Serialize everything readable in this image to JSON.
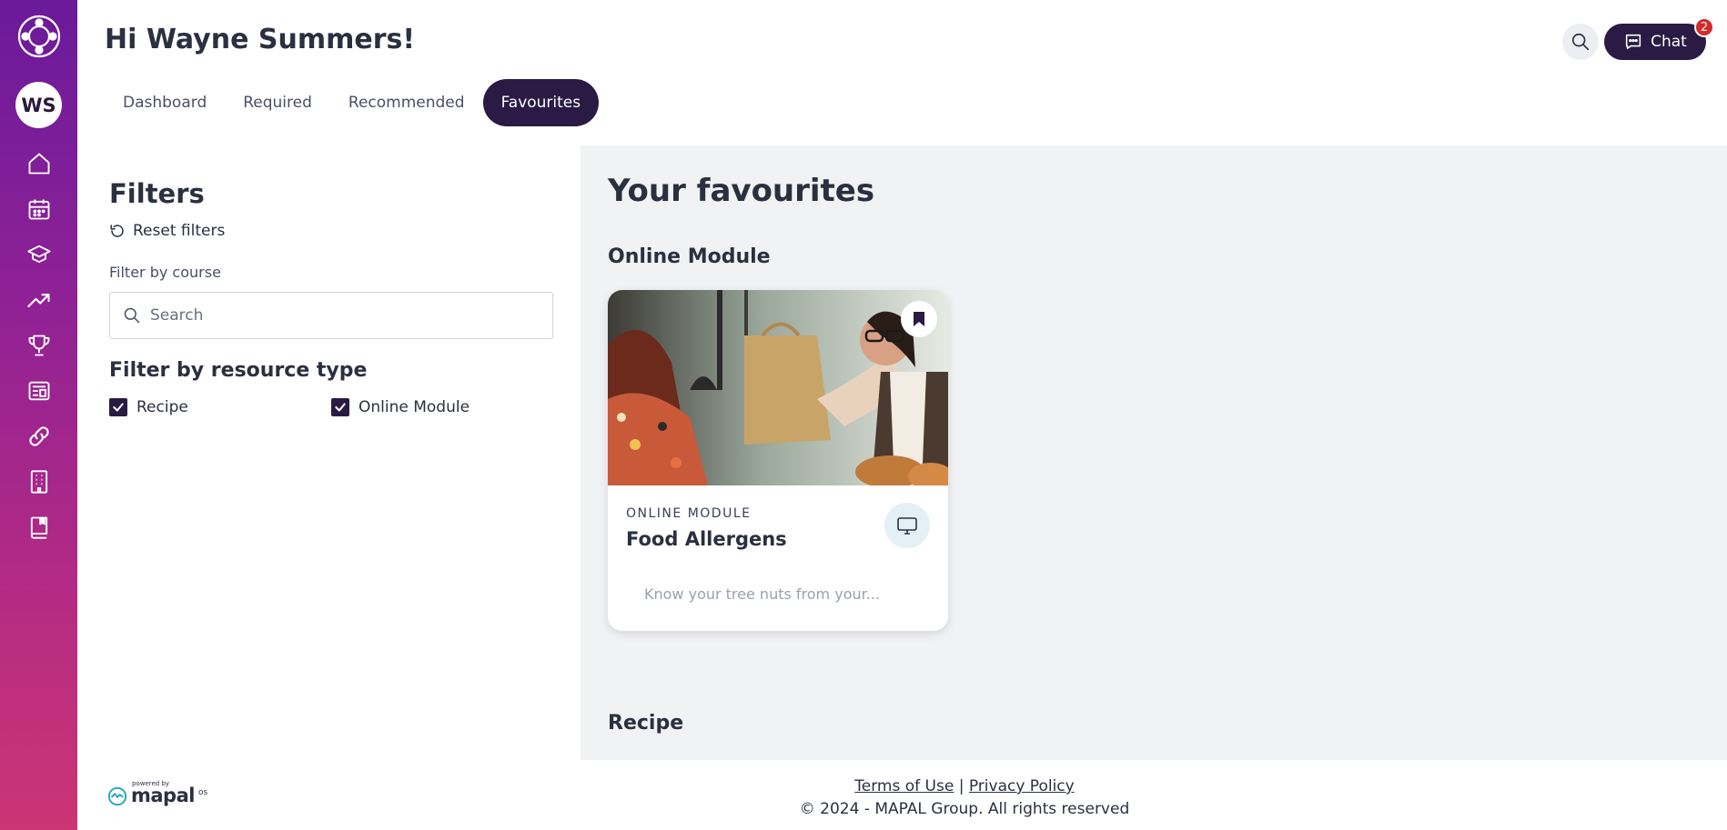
{
  "user": {
    "initials": "WS",
    "greeting": "Hi Wayne Summers!"
  },
  "sidebar": {
    "items": [
      {
        "icon": "home-icon"
      },
      {
        "icon": "calendar-icon"
      },
      {
        "icon": "graduation-cap-icon"
      },
      {
        "icon": "trending-up-icon"
      },
      {
        "icon": "trophy-icon"
      },
      {
        "icon": "news-icon"
      },
      {
        "icon": "link-icon"
      },
      {
        "icon": "building-icon"
      },
      {
        "icon": "book-icon"
      }
    ]
  },
  "tabs": [
    {
      "label": "Dashboard",
      "active": false
    },
    {
      "label": "Required",
      "active": false
    },
    {
      "label": "Recommended",
      "active": false
    },
    {
      "label": "Favourites",
      "active": true
    }
  ],
  "header": {
    "chat_label": "Chat",
    "chat_badge": "2"
  },
  "filters": {
    "title": "Filters",
    "reset_label": "Reset filters",
    "course_label": "Filter by course",
    "search_placeholder": "Search",
    "resource_type_title": "Filter by resource type",
    "resource_types": [
      {
        "label": "Recipe",
        "checked": true
      },
      {
        "label": "Online Module",
        "checked": true
      }
    ]
  },
  "main": {
    "title": "Your favourites",
    "sections": [
      {
        "title": "Online Module",
        "cards": [
          {
            "type": "ONLINE MODULE",
            "title": "Food Allergens",
            "description": "Know your tree nuts from your...",
            "icon": "monitor-icon"
          }
        ]
      },
      {
        "title": "Recipe"
      }
    ]
  },
  "footer": {
    "powered_by": "powered by",
    "brand": "mapal",
    "brand_suffix": "os",
    "terms": "Terms of Use",
    "separator": "|",
    "privacy": "Privacy Policy",
    "copyright": "© 2024 - MAPAL Group. All rights reserved"
  },
  "colors": {
    "accent": "#2a1a44",
    "sidebar_top": "#6a1a9a",
    "sidebar_bottom": "#cc3574",
    "badge": "#d42a2a"
  }
}
